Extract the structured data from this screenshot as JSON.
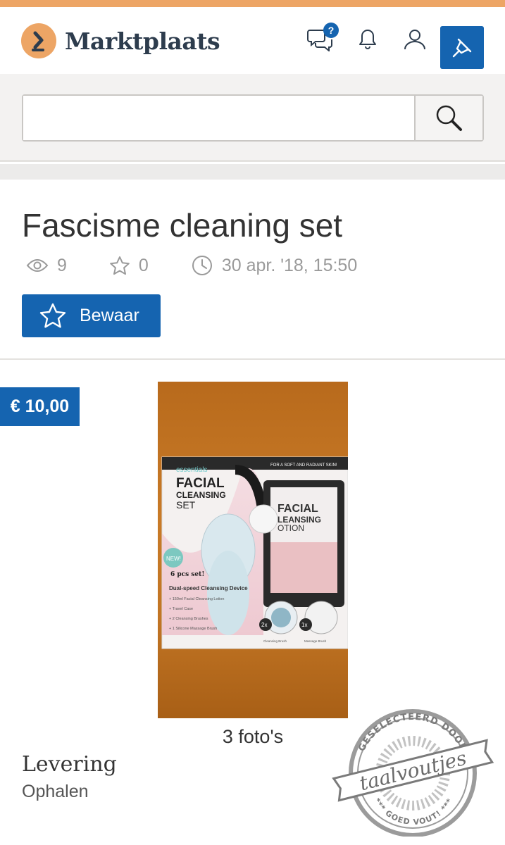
{
  "header": {
    "brand": "Marktplaats",
    "messages_badge": "?",
    "icons": [
      "chat-icon",
      "bell-icon",
      "user-icon",
      "pin-icon"
    ],
    "accent_color": "#eda565",
    "primary_color": "#1564b0"
  },
  "search": {
    "value": "",
    "placeholder": ""
  },
  "listing": {
    "title": "Fascisme cleaning set",
    "views": "9",
    "favorites": "0",
    "posted": "30 apr. '18, 15:50",
    "save_label": "Bewaar",
    "price": "€ 10,00",
    "photo_count": "3 foto's",
    "delivery_label": "Levering",
    "delivery_value": "Ophalen"
  },
  "product_box": {
    "brand": "essentials",
    "line1": "FACIAL",
    "line2": "CLEANSING",
    "line3": "SET",
    "tagline": "FOR A SOFT AND RADIANT SKIN!",
    "new": "NEW!",
    "pcs": "6 pcs set!",
    "device": "Dual-speed Cleansing Device",
    "items": [
      "+ 150ml Facial Cleansing Lotion",
      "+ Travel Case",
      "+ 2 Cleansing Brushes",
      "+ 1 Silicone Massage Brush"
    ],
    "tube_line1": "FACIAL",
    "tube_line2": "LEANSING",
    "tube_line3": "OTION",
    "badge_2x": "2x",
    "badge_1x": "1x",
    "cap1": "Cleansing Brush",
    "cap2": "Massage Brush"
  },
  "stamp": {
    "top": "GESELECTEERD DOOR",
    "middle": "taalvoutjes",
    "bottom": "*** GOED VOUT! ***"
  }
}
